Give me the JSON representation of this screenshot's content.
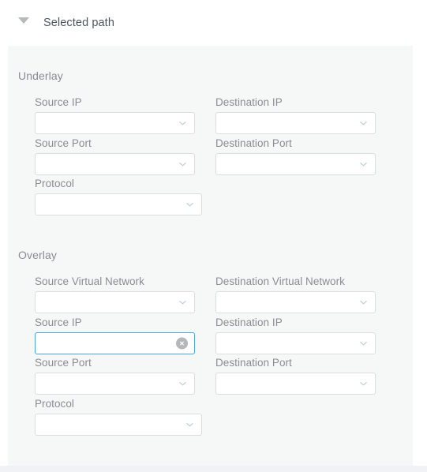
{
  "header": {
    "title": "Selected path",
    "collapse_icon": "triangle-down-icon"
  },
  "colors": {
    "panel_bg": "#f6f7f7",
    "page_bg": "#ffffff",
    "focus_border": "#4ba3e3",
    "field_border": "#dcdddf",
    "label_text": "#8a8d90",
    "title_text": "#4b5560",
    "clear_button": "#b5b7b9",
    "bottom_strip": "#f1f2f5"
  },
  "sections": [
    {
      "title": "Underlay",
      "fields": [
        {
          "label": "Source IP",
          "column": "left",
          "type": "select",
          "value": "",
          "placeholder": ""
        },
        {
          "label": "Destination IP",
          "column": "right",
          "type": "select",
          "value": "",
          "placeholder": ""
        },
        {
          "label": "Source Port",
          "column": "left",
          "type": "select",
          "value": "",
          "placeholder": ""
        },
        {
          "label": "Destination Port",
          "column": "right",
          "type": "select",
          "value": "",
          "placeholder": ""
        },
        {
          "label": "Protocol",
          "column": "left",
          "type": "select",
          "value": "",
          "placeholder": ""
        }
      ]
    },
    {
      "title": "Overlay",
      "fields": [
        {
          "label": "Source Virtual Network",
          "column": "left",
          "type": "select",
          "value": "",
          "placeholder": ""
        },
        {
          "label": "Destination Virtual Network",
          "column": "right",
          "type": "select",
          "value": "",
          "placeholder": ""
        },
        {
          "label": "Source IP",
          "column": "left",
          "type": "input",
          "value": "",
          "placeholder": "",
          "focused": true,
          "clearable": true
        },
        {
          "label": "Destination IP",
          "column": "right",
          "type": "select",
          "value": "",
          "placeholder": ""
        },
        {
          "label": "Source Port",
          "column": "left",
          "type": "select",
          "value": "",
          "placeholder": ""
        },
        {
          "label": "Destination Port",
          "column": "right",
          "type": "select",
          "value": "",
          "placeholder": ""
        },
        {
          "label": "Protocol",
          "column": "left",
          "type": "select",
          "value": "",
          "placeholder": ""
        }
      ]
    }
  ],
  "icons": {
    "chevron_down": "chevron-down-icon",
    "clear": "clear-circle-icon"
  }
}
